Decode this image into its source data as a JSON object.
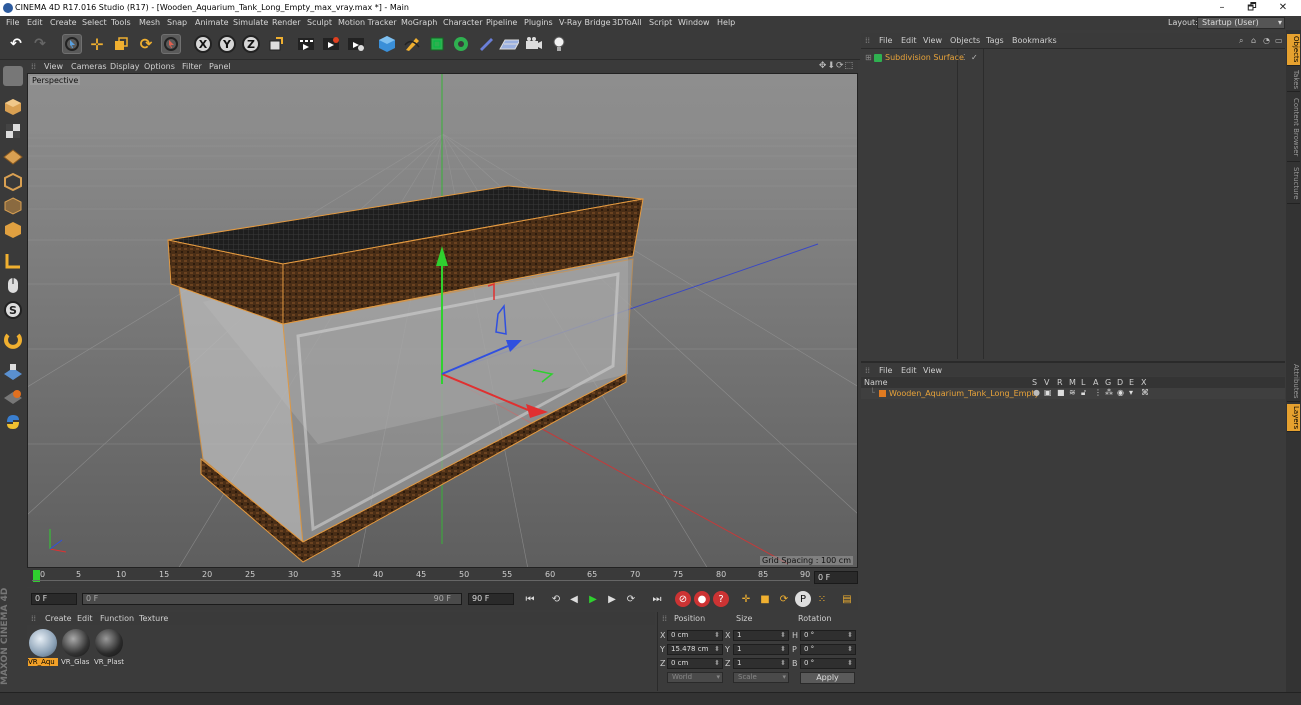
{
  "window": {
    "title": "CINEMA 4D R17.016 Studio (R17) - [Wooden_Aquarium_Tank_Long_Empty_max_vray.max *] - Main",
    "minimize": "–",
    "restore": "🗗",
    "close": "✕"
  },
  "menubar": {
    "items": [
      "File",
      "Edit",
      "Create",
      "Select",
      "Tools",
      "Mesh",
      "Snap",
      "Animate",
      "Simulate",
      "Render",
      "Sculpt",
      "Motion Tracker",
      "MoGraph",
      "Character",
      "Pipeline",
      "Plugins",
      "V-Ray Bridge",
      "3DToAll",
      "Script",
      "Window",
      "Help"
    ],
    "layout_label": "Layout:",
    "layout_value": "Startup (User)"
  },
  "toolbar": {
    "axis_x": "X",
    "axis_y": "Y",
    "axis_z": "Z"
  },
  "viewport": {
    "menu": [
      "View",
      "Cameras",
      "Display",
      "Options",
      "Filter",
      "Panel"
    ],
    "camera_label": "Perspective",
    "grid_spacing": "Grid Spacing : 100 cm",
    "nav_icons": "✥⬇⟳⬚"
  },
  "timeline": {
    "ticks": [
      "0",
      "5",
      "10",
      "15",
      "20",
      "25",
      "30",
      "35",
      "40",
      "45",
      "50",
      "55",
      "60",
      "65",
      "70",
      "75",
      "80",
      "85",
      "90"
    ],
    "end_field": "0 F"
  },
  "transport": {
    "current_frame": "0 F",
    "slider_start": "0 F",
    "slider_end": "90 F",
    "end_frame": "90 F"
  },
  "material_manager": {
    "menu": [
      "Create",
      "Edit",
      "Function",
      "Texture"
    ],
    "materials": [
      {
        "label": "VR_Aqu",
        "selected": true
      },
      {
        "label": "VR_Glas",
        "selected": false
      },
      {
        "label": "VR_Plast",
        "selected": false
      }
    ],
    "brand": "MAXON",
    "brand_sub": "CINEMA 4D"
  },
  "coordinates": {
    "headers": {
      "position": "Position",
      "size": "Size",
      "rotation": "Rotation"
    },
    "rows": [
      {
        "axis": "X",
        "pos": "0 cm",
        "size_axis": "X",
        "size": "1",
        "rot_axis": "H",
        "rot": "0 °"
      },
      {
        "axis": "Y",
        "pos": "15.478 cm",
        "size_axis": "Y",
        "size": "1",
        "rot_axis": "P",
        "rot": "0 °"
      },
      {
        "axis": "Z",
        "pos": "0 cm",
        "size_axis": "Z",
        "size": "1",
        "rot_axis": "B",
        "rot": "0 °"
      }
    ],
    "mode_world": "World",
    "mode_scale": "Scale",
    "apply": "Apply"
  },
  "object_manager": {
    "menu": [
      "File",
      "Edit",
      "View",
      "Objects",
      "Tags",
      "Bookmarks"
    ],
    "object_name": "Subdivision Surface"
  },
  "layer_manager": {
    "menu": [
      "File",
      "Edit",
      "View"
    ],
    "columns": [
      "Name",
      "S",
      "V",
      "R",
      "M",
      "L",
      "A",
      "G",
      "D",
      "E",
      "X"
    ],
    "layer_name": "Wooden_Aquarium_Tank_Long_Empty"
  },
  "side_tabs": [
    "Objects",
    "Takes",
    "Content Browser",
    "Structure",
    "Attributes",
    "Layers"
  ],
  "colors": {
    "accent": "#e6a12f",
    "panel": "#3b3b3b",
    "viewport": "#8a8a8a",
    "object_text": "#e8a33a"
  }
}
